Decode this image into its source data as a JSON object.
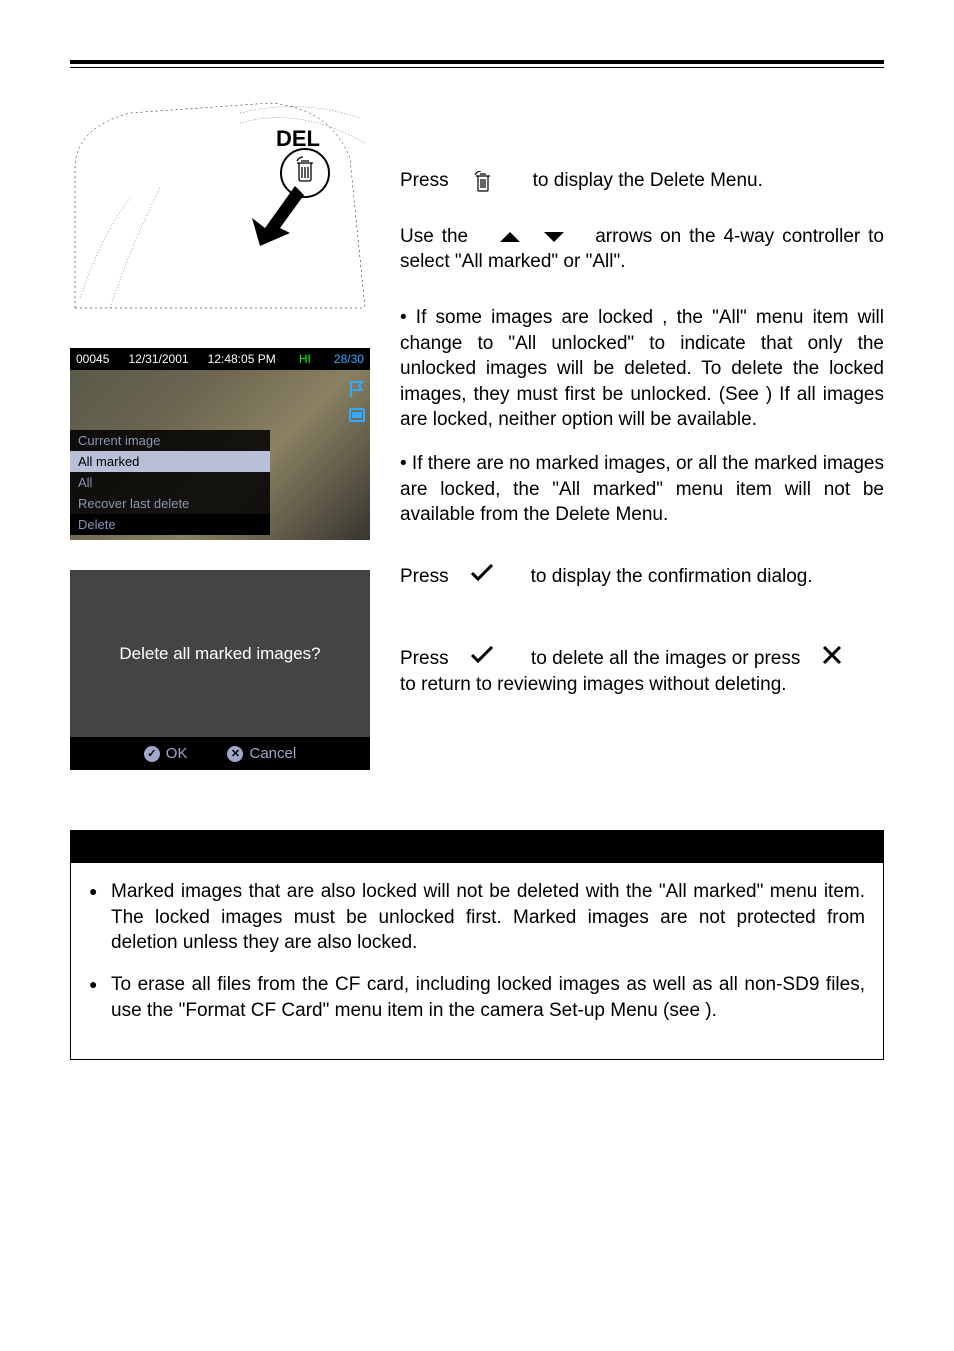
{
  "camera_label": "DEL",
  "screenshot1": {
    "number": "00045",
    "date": "12/31/2001",
    "time": "12:48:05 PM",
    "quality": "HI",
    "count": "28/30",
    "menu_items": [
      "Current image",
      "All marked",
      "All",
      "Recover last delete"
    ],
    "menu_title": "Delete"
  },
  "screenshot2": {
    "prompt": "Delete all marked images?",
    "ok_label": "OK",
    "cancel_label": "Cancel"
  },
  "steps": {
    "s1_a": "Press",
    "s1_b": "to display the Delete Menu.",
    "s2_a": "Use the",
    "s2_b": "arrows on the 4-way controller to select \"All marked\" or \"All\".",
    "bullet1": "• If some images are locked , the \"All\" menu item will change to \"All unlocked\" to indicate that only the unlocked images will be deleted.   To delete the locked images, they must first be unlocked.  (See         )  If all images are locked, neither option will be available.",
    "bullet2": "• If there are no marked images, or all the marked images are locked, the \"All marked\" menu item will not be available from the Delete Menu.",
    "s3_a": "Press",
    "s3_b": "to display the confirmation dialog.",
    "s4_a": "Press",
    "s4_b": "to delete all the images or press",
    "s4_c": "to return to reviewing images without deleting."
  },
  "notes": {
    "item1": "Marked images that are also locked will not be deleted with the \"All marked\" menu item.    The locked images must be unlocked first.    Marked images are not protected from deletion unless they are also locked.",
    "item2": "To erase all files from the CF card, including locked images as well as all non-SD9 files, use the \"Format CF Card\" menu item in the camera Set-up Menu (see        )."
  }
}
